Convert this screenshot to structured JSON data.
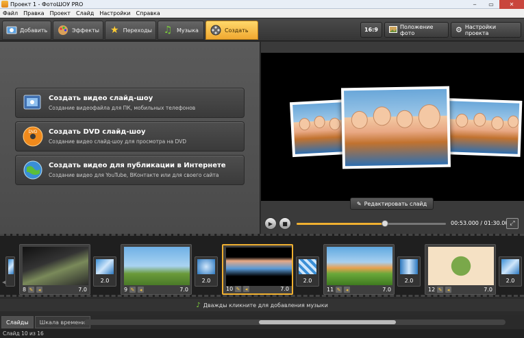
{
  "window": {
    "title": "Проект 1 - ФотоШОУ PRO",
    "min": "‒",
    "max": "▭",
    "close": "✕"
  },
  "menu": [
    "Файл",
    "Правка",
    "Проект",
    "Слайд",
    "Настройки",
    "Справка"
  ],
  "toolbar": {
    "tabs": [
      {
        "label": "Добавить",
        "icon": "add-photo-icon"
      },
      {
        "label": "Эффекты",
        "icon": "palette-icon"
      },
      {
        "label": "Переходы",
        "icon": "star-icon"
      },
      {
        "label": "Музыка",
        "icon": "music-note-icon"
      },
      {
        "label": "Создать",
        "icon": "film-reel-icon"
      }
    ],
    "aspect": "16:9",
    "photo_position": "Положение фото",
    "project_settings": "Настройки проекта"
  },
  "actions": [
    {
      "title": "Создать видео слайд-шоу",
      "subtitle": "Создание видеофайла для ПК, мобильных телефонов",
      "icon": "video-file-icon"
    },
    {
      "title": "Создать DVD слайд-шоу",
      "subtitle": "Создание видео слайд-шоу для просмотра на DVD",
      "icon": "dvd-disc-icon"
    },
    {
      "title": "Создать видео для публикации в Интернете",
      "subtitle": "Создание видео для YouTube, ВКонтакте или для своего сайта",
      "icon": "globe-icon"
    }
  ],
  "preview": {
    "edit_slide": "Редактировать слайд",
    "progress": 0.59,
    "timecode": "00:53.000 / 01:30.000"
  },
  "slides": [
    {
      "num": "8",
      "duration": "7.0"
    },
    {
      "num": "9",
      "duration": "7.0"
    },
    {
      "num": "10",
      "duration": "7.0"
    },
    {
      "num": "11",
      "duration": "7.0"
    },
    {
      "num": "12",
      "duration": "7.0"
    }
  ],
  "transitions": [
    "2.0",
    "2.0",
    "2.0",
    "2.0",
    "2.0"
  ],
  "music_hint": "Дважды кликните для добавления музыки",
  "bottom_tabs": [
    "Слайды",
    "Шкала времени"
  ],
  "status": "Слайд 10 из 16",
  "colors": {
    "accent": "#f0b030",
    "background": "#2b2b2b"
  }
}
